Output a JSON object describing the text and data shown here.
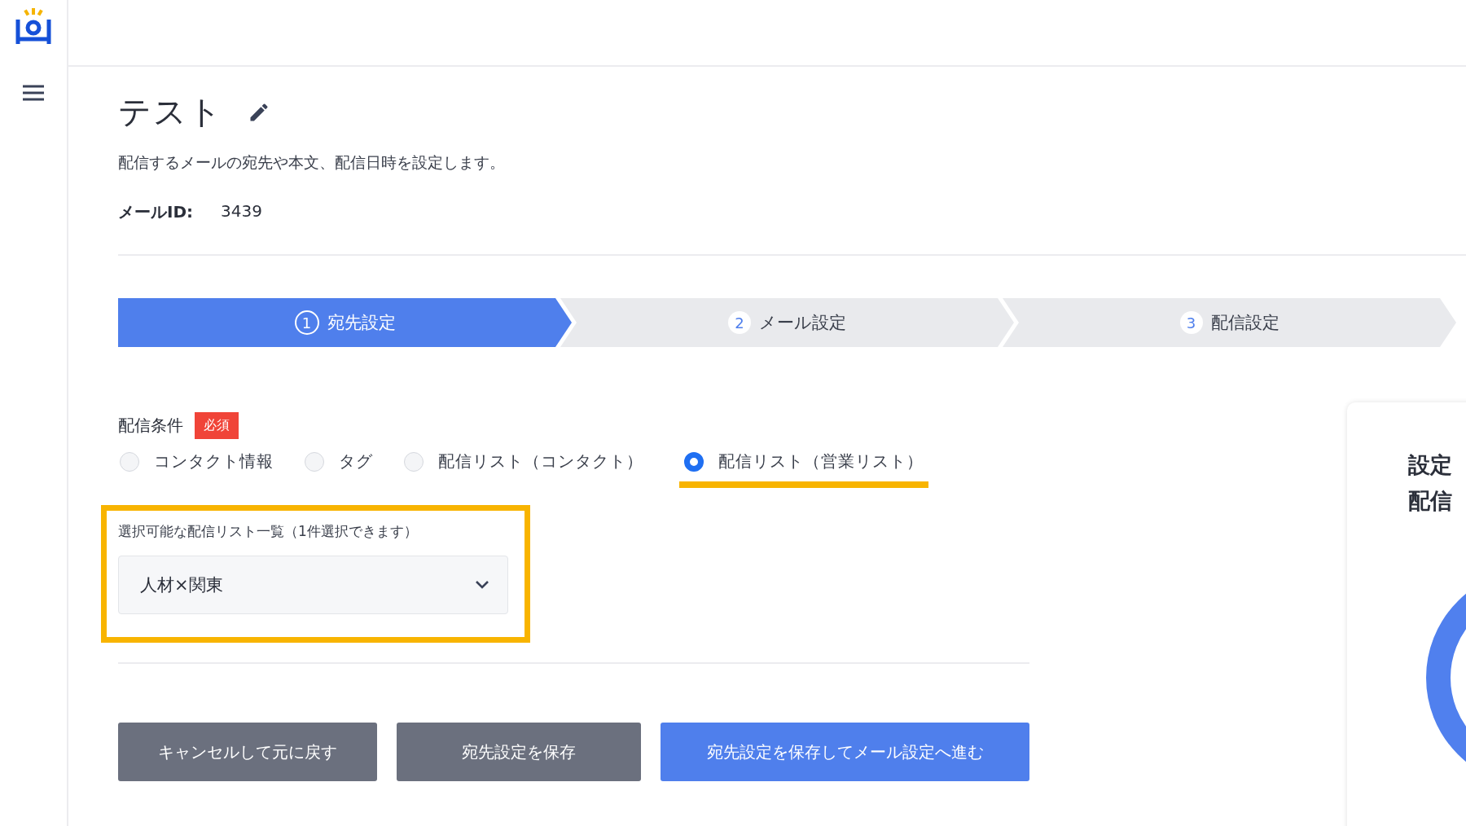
{
  "page": {
    "title": "テスト",
    "description": "配信するメールの宛先や本文、配信日時を設定します。",
    "mail_id_label": "メールID:",
    "mail_id": "3439"
  },
  "steps": [
    {
      "number": "1",
      "label": "宛先設定",
      "selected": true
    },
    {
      "number": "2",
      "label": "メール設定",
      "selected": false
    },
    {
      "number": "3",
      "label": "配信設定",
      "selected": false
    }
  ],
  "delivery_condition": {
    "label": "配信条件",
    "required_badge": "必須",
    "options": [
      {
        "label": "コンタクト情報",
        "selected": false
      },
      {
        "label": "タグ",
        "selected": false
      },
      {
        "label": "配信リスト（コンタクト）",
        "selected": false
      },
      {
        "label": "配信リスト（営業リスト）",
        "selected": true
      }
    ]
  },
  "list_select": {
    "label": "選択可能な配信リスト一覧（1件選択できます）",
    "value": "人材×関東"
  },
  "buttons": [
    {
      "label": "キャンセルして元に戻す",
      "kind": "secondary"
    },
    {
      "label": "宛先設定を保存",
      "kind": "secondary"
    },
    {
      "label": "宛先設定を保存してメール設定へ進む",
      "kind": "primary"
    }
  ],
  "side_card": {
    "lines": [
      "設定",
      "配信"
    ]
  }
}
